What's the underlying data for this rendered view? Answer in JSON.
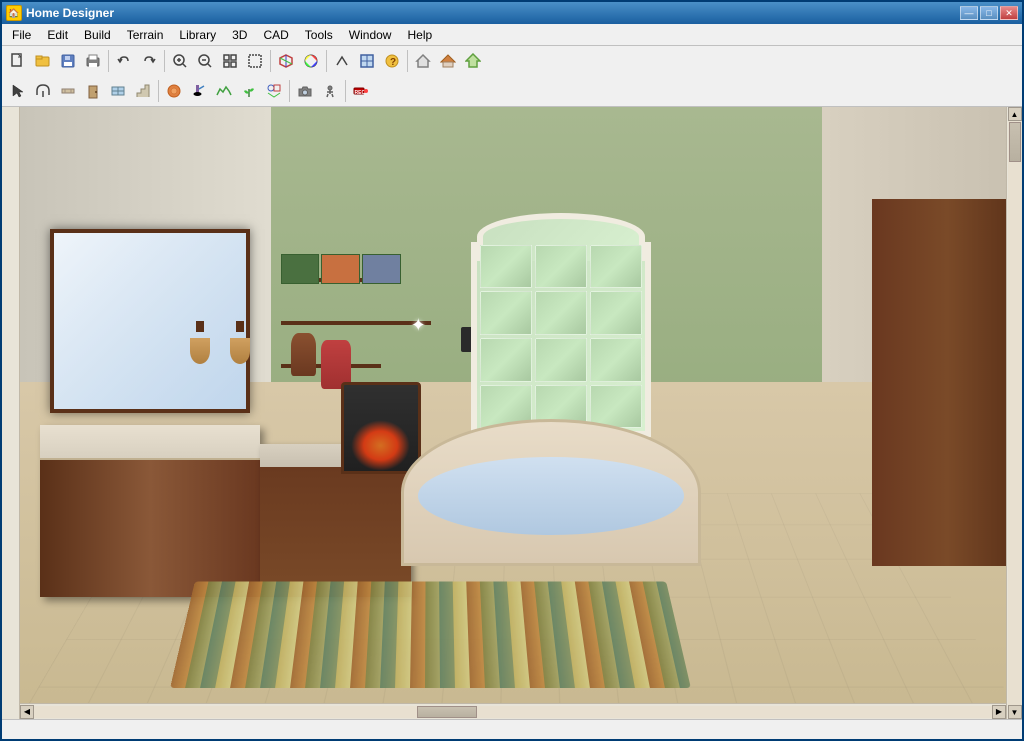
{
  "window": {
    "title": "Home Designer",
    "icon": "🏠"
  },
  "titlebar": {
    "minimize": "—",
    "maximize": "□",
    "close": "✕"
  },
  "menu": {
    "items": [
      "File",
      "Edit",
      "Build",
      "Terrain",
      "Library",
      "3D",
      "CAD",
      "Tools",
      "Window",
      "Help"
    ]
  },
  "toolbar": {
    "row1_buttons": [
      "new",
      "open",
      "save",
      "print",
      "undo",
      "redo",
      "zoom-in",
      "zoom-out",
      "fit",
      "select",
      "fill",
      "move",
      "rotate",
      "scale",
      "mirror",
      "delete",
      "measure",
      "text",
      "camera",
      "record"
    ],
    "row2_buttons": [
      "select-arrow",
      "wall",
      "room",
      "door",
      "window",
      "stair",
      "roof",
      "dimension",
      "material",
      "terrain",
      "plant",
      "furniture",
      "camera-3d"
    ]
  },
  "statusbar": {
    "text": ""
  }
}
